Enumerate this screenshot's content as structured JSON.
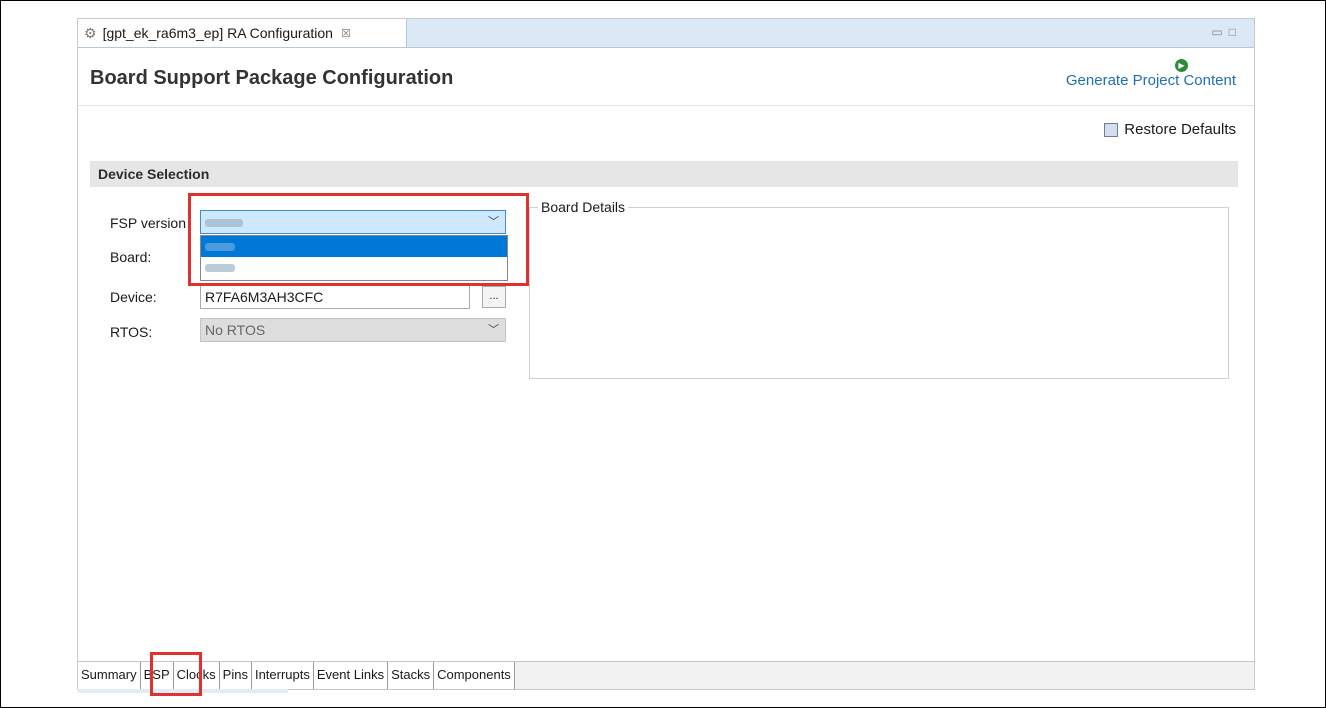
{
  "editor_tab": {
    "title": "[gpt_ek_ra6m3_ep] RA Configuration",
    "close_glyph": "☒",
    "gear_icon": "gear-icon"
  },
  "window_controls": {
    "minimize": "▭",
    "maximize": "□"
  },
  "header": {
    "title": "Board Support Package Configuration",
    "generate_label": "Generate Project Content"
  },
  "toolbar": {
    "restore_label": "Restore Defaults"
  },
  "device_selection": {
    "section_title": "Device Selection",
    "fsp_label": "FSP version",
    "board_label": "Board:",
    "device_label": "Device:",
    "device_value": "R7FA6M3AH3CFC",
    "browse_label": "...",
    "rtos_label": "RTOS:",
    "rtos_value": "No RTOS"
  },
  "board_details": {
    "legend": "Board Details"
  },
  "bottom_tabs": [
    "Summary",
    "BSP",
    "Clocks",
    "Pins",
    "Interrupts",
    "Event Links",
    "Stacks",
    "Components"
  ],
  "colors": {
    "highlight": "#e03030",
    "accent": "#1f6fb5",
    "selection": "#0078d7"
  }
}
